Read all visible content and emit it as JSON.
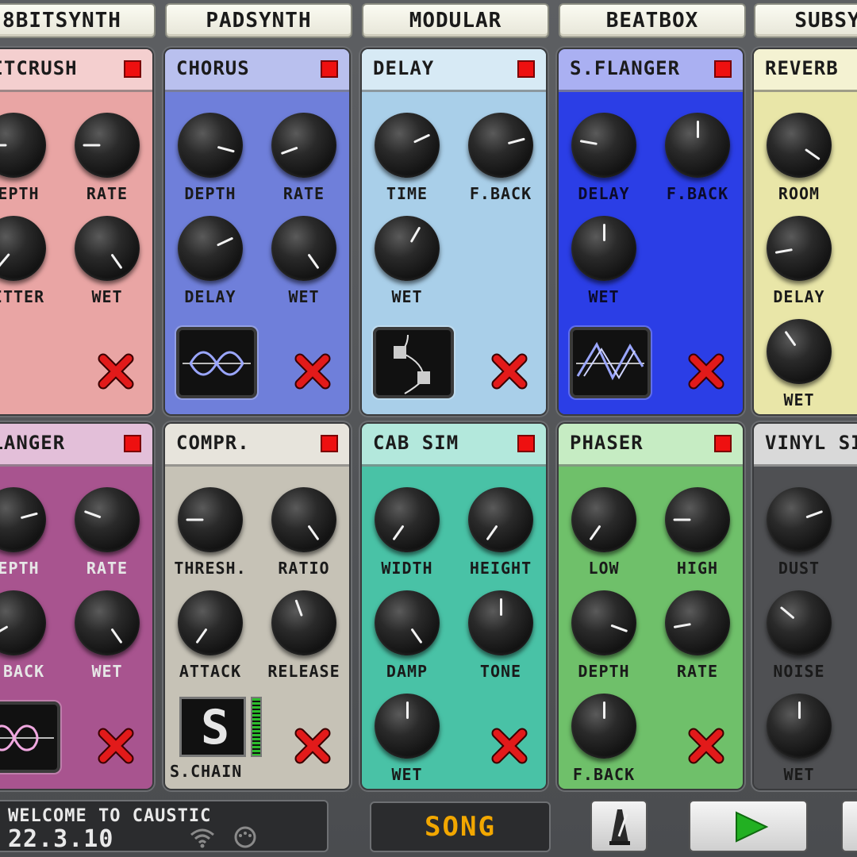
{
  "tabs": [
    "8BITSYNTH",
    "PADSYNTH",
    "MODULAR",
    "BEATBOX",
    "SUBSYNTH"
  ],
  "effects": [
    {
      "id": "bitcrush",
      "title": "BITCRUSH",
      "color": "#e9a5a4",
      "head_color": "#f4cfcf",
      "knobs": [
        {
          "label": "DEPTH",
          "angle": -90
        },
        {
          "label": "RATE",
          "angle": -90
        },
        {
          "label": "JITTER",
          "angle": -140
        },
        {
          "label": "WET",
          "angle": 145
        }
      ],
      "mode": null
    },
    {
      "id": "chorus",
      "title": "CHORUS",
      "color": "#6f7fda",
      "head_color": "#b9c0ee",
      "knobs": [
        {
          "label": "DEPTH",
          "angle": 105
        },
        {
          "label": "RATE",
          "angle": -110
        },
        {
          "label": "DELAY",
          "angle": 65
        },
        {
          "label": "WET",
          "angle": 145
        }
      ],
      "mode": "chorus-wave"
    },
    {
      "id": "delay",
      "title": "DELAY",
      "color": "#a9cfe9",
      "head_color": "#d7eaf5",
      "knobs": [
        {
          "label": "TIME",
          "angle": 65
        },
        {
          "label": "F.BACK",
          "angle": 75
        },
        {
          "label": "WET",
          "angle": 30
        }
      ],
      "mode": "delay-curve"
    },
    {
      "id": "sflanger",
      "title": "S.FLANGER",
      "color": "#2b3ee6",
      "head_color": "#aab0f2",
      "knobs": [
        {
          "label": "DELAY",
          "angle": -80
        },
        {
          "label": "F.BACK",
          "angle": 0
        },
        {
          "label": "WET",
          "angle": 0
        }
      ],
      "mode": "flanger-wave"
    },
    {
      "id": "reverb",
      "title": "REVERB",
      "color": "#e9e6a8",
      "head_color": "#f4f2d2",
      "knobs": [
        {
          "label": "ROOM",
          "angle": 125
        },
        {
          "label": "DELAY",
          "angle": -100
        },
        {
          "label": "WET",
          "angle": -35
        }
      ],
      "mode": null
    },
    {
      "id": "flanger",
      "title": "FLANGER",
      "color": "#a8548f",
      "head_color": "#e3bfd9",
      "knobs": [
        {
          "label": "DEPTH",
          "angle": 75
        },
        {
          "label": "RATE",
          "angle": -70
        },
        {
          "label": "F.BACK",
          "angle": -120
        },
        {
          "label": "WET",
          "angle": 145
        }
      ],
      "mode": "flanger-loop"
    },
    {
      "id": "compr",
      "title": "COMPR.",
      "color": "#c6c2b6",
      "head_color": "#e7e4dc",
      "knobs": [
        {
          "label": "THRESH.",
          "angle": -90
        },
        {
          "label": "RATIO",
          "angle": 145
        },
        {
          "label": "ATTACK",
          "angle": -145
        },
        {
          "label": "RELEASE",
          "angle": -20
        }
      ],
      "schain_label": "S.CHAIN",
      "schain_value": "S",
      "mode": "compressor"
    },
    {
      "id": "cabsim",
      "title": "CAB SIM",
      "color": "#49c2a6",
      "head_color": "#b3e8dc",
      "knobs": [
        {
          "label": "WIDTH",
          "angle": -145
        },
        {
          "label": "HEIGHT",
          "angle": -145
        },
        {
          "label": "DAMP",
          "angle": 145
        },
        {
          "label": "TONE",
          "angle": 0
        },
        {
          "label": "WET",
          "angle": 0
        }
      ],
      "mode": null
    },
    {
      "id": "phaser",
      "title": "PHASER",
      "color": "#6fc06a",
      "head_color": "#c6ecc3",
      "knobs": [
        {
          "label": "LOW",
          "angle": -145
        },
        {
          "label": "HIGH",
          "angle": -90
        },
        {
          "label": "DEPTH",
          "angle": 110
        },
        {
          "label": "RATE",
          "angle": -100
        },
        {
          "label": "F.BACK",
          "angle": 0
        }
      ],
      "mode": null
    },
    {
      "id": "vinylsim",
      "title": "VINYL SIM",
      "color": "#4f5053",
      "head_color": "#d9d9d9",
      "knobs": [
        {
          "label": "DUST",
          "angle": 70
        },
        {
          "label": "NOISE",
          "angle": -50
        },
        {
          "label": "WET",
          "angle": 0
        }
      ],
      "mode": null
    }
  ],
  "status": {
    "line1": "WELCOME TO CAUSTIC",
    "line2": "22.3.10"
  },
  "song_button": "SONG",
  "colors": {
    "power": "#ee1010",
    "x": "#e21a1a",
    "song_text": "#f2a700",
    "play": "#22b022"
  }
}
